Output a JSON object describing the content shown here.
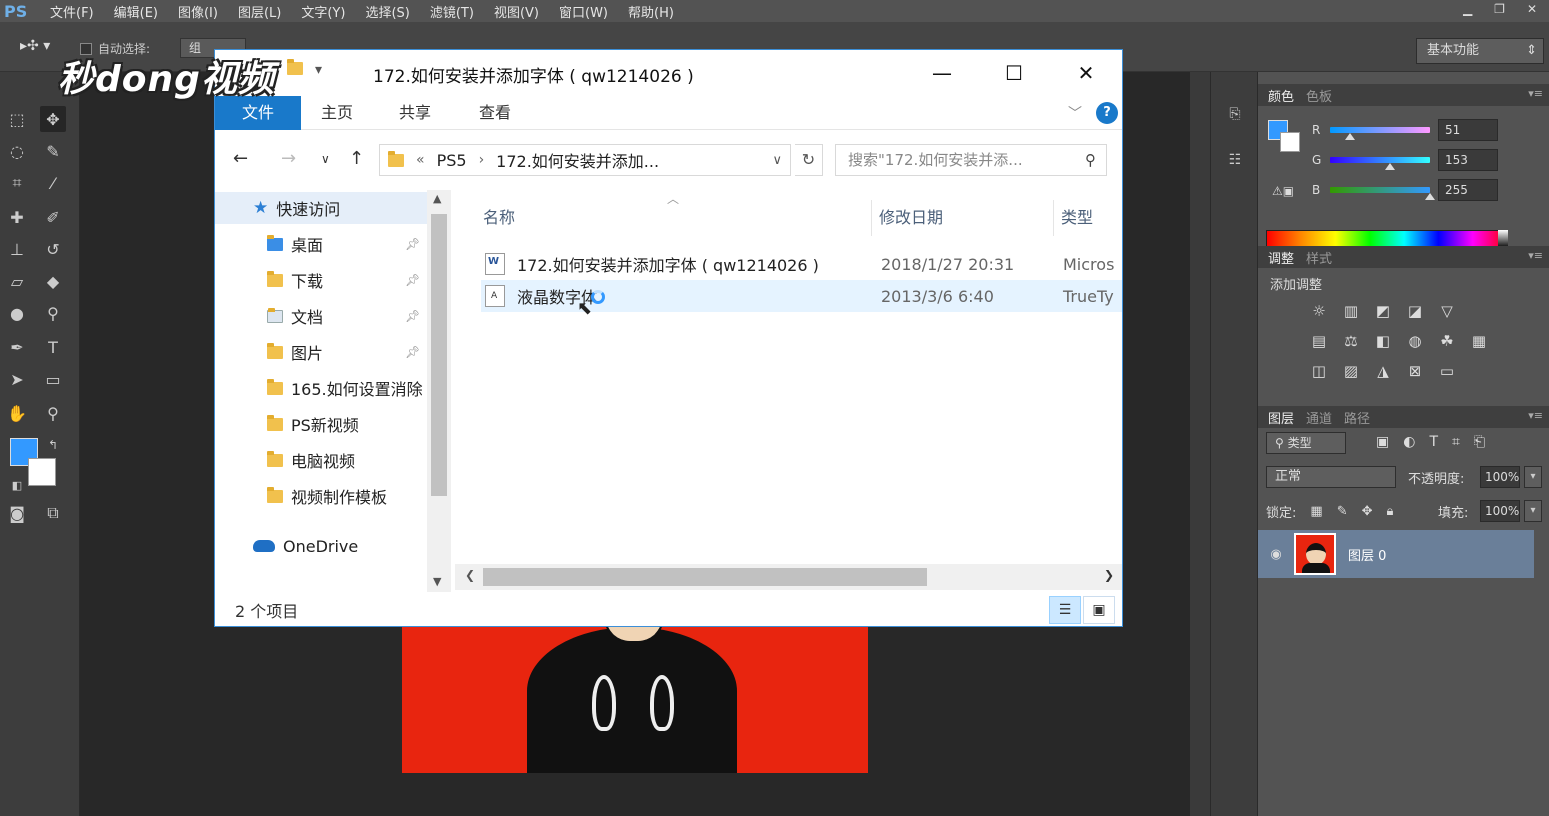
{
  "photoshop": {
    "logo": "PS",
    "menu": [
      "文件(F)",
      "编辑(E)",
      "图像(I)",
      "图层(L)",
      "文字(Y)",
      "选择(S)",
      "滤镜(T)",
      "视图(V)",
      "窗口(W)",
      "帮助(H)"
    ],
    "options": {
      "auto_select_label": "自动选择:",
      "auto_select_value": "组",
      "workspace": "基本功能"
    },
    "color_panel": {
      "tabs": [
        "颜色",
        "色板"
      ],
      "r_label": "R",
      "r_value": "51",
      "g_label": "G",
      "g_value": "153",
      "b_label": "B",
      "b_value": "255",
      "foreground": "#3399ff",
      "background": "#ffffff"
    },
    "adjust_panel": {
      "tabs": [
        "调整",
        "样式"
      ],
      "title": "添加调整"
    },
    "layers_panel": {
      "tabs": [
        "图层",
        "通道",
        "路径"
      ],
      "filter": "类型",
      "blend_mode": "正常",
      "opacity_label": "不透明度:",
      "opacity_value": "100%",
      "lock_label": "锁定:",
      "fill_label": "填充:",
      "fill_value": "100%",
      "layer_name": "图层 0"
    }
  },
  "explorer": {
    "title": "172.如何安装并添加字体 ( qw1214026 )",
    "ribbon": {
      "file": "文件",
      "tabs": [
        "主页",
        "共享",
        "查看"
      ]
    },
    "address": {
      "overflow": "«",
      "crumb_1": "PS5",
      "crumb_2": "172.如何安装并添加..."
    },
    "search_placeholder": "搜索\"172.如何安装并添...",
    "nav": {
      "quick_access": "快速访问",
      "items": [
        "桌面",
        "下载",
        "文档",
        "图片",
        "165.如何设置消除",
        "PS新视频",
        "电脑视频",
        "视频制作模板"
      ],
      "onedrive": "OneDrive"
    },
    "columns": {
      "name": "名称",
      "date": "修改日期",
      "type": "类型"
    },
    "files": [
      {
        "name": "172.如何安装并添加字体 ( qw1214026 )",
        "date": "2018/1/27 20:31",
        "type": "Micros"
      },
      {
        "name": "液晶数字体",
        "date": "2013/3/6 6:40",
        "type": "TrueTy"
      }
    ],
    "status": "2 个项目"
  },
  "watermark": "秒dong视频"
}
